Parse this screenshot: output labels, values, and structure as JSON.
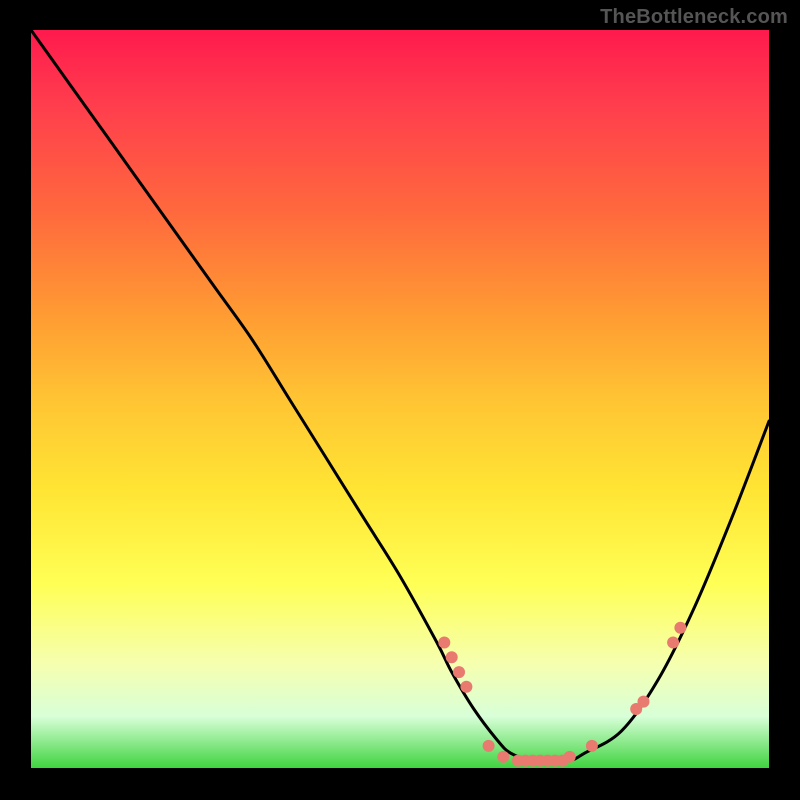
{
  "watermark": "TheBottleneck.com",
  "colors": {
    "background": "#000000",
    "gradient_top": "#ff1a4d",
    "gradient_bottom": "#3fd43f",
    "curve": "#000000",
    "dots": "#e87a6f"
  },
  "chart_data": {
    "type": "line",
    "title": "",
    "xlabel": "",
    "ylabel": "",
    "xlim": [
      0,
      100
    ],
    "ylim": [
      0,
      100
    ],
    "series": [
      {
        "name": "bottleneck-curve",
        "x": [
          0,
          5,
          10,
          15,
          20,
          25,
          30,
          35,
          40,
          45,
          50,
          55,
          57,
          60,
          63,
          65,
          68,
          70,
          73,
          75,
          80,
          85,
          90,
          95,
          100
        ],
        "y": [
          100,
          93,
          86,
          79,
          72,
          65,
          58,
          50,
          42,
          34,
          26,
          17,
          13,
          8,
          4,
          2,
          1,
          1,
          1,
          2,
          5,
          12,
          22,
          34,
          47
        ]
      }
    ],
    "markers": [
      {
        "x": 56,
        "y": 17
      },
      {
        "x": 57,
        "y": 15
      },
      {
        "x": 58,
        "y": 13
      },
      {
        "x": 59,
        "y": 11
      },
      {
        "x": 62,
        "y": 3
      },
      {
        "x": 64,
        "y": 1.5
      },
      {
        "x": 66,
        "y": 1
      },
      {
        "x": 67,
        "y": 1
      },
      {
        "x": 68,
        "y": 1
      },
      {
        "x": 69,
        "y": 1
      },
      {
        "x": 70,
        "y": 1
      },
      {
        "x": 71,
        "y": 1
      },
      {
        "x": 72,
        "y": 1
      },
      {
        "x": 73,
        "y": 1.5
      },
      {
        "x": 76,
        "y": 3
      },
      {
        "x": 82,
        "y": 8
      },
      {
        "x": 83,
        "y": 9
      },
      {
        "x": 87,
        "y": 17
      },
      {
        "x": 88,
        "y": 19
      }
    ]
  }
}
